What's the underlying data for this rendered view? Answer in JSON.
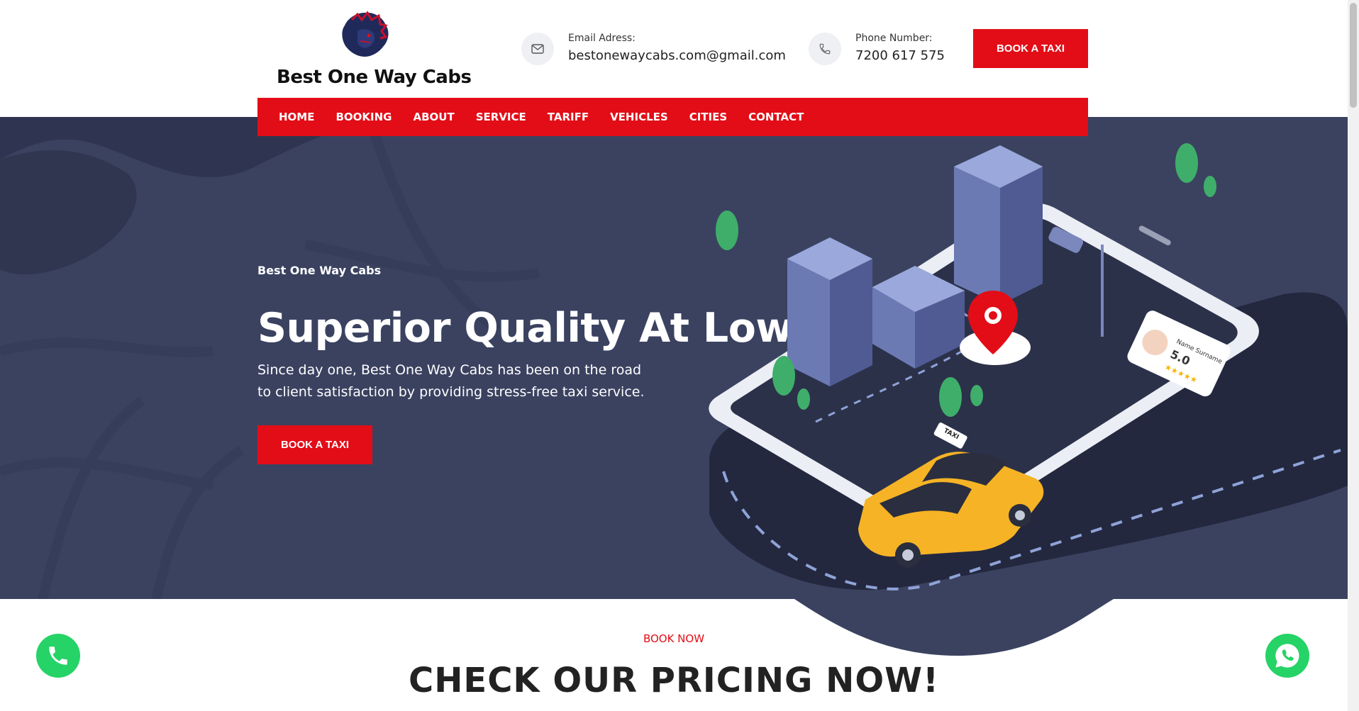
{
  "brand": {
    "name": "Best One Way Cabs"
  },
  "contact": {
    "email_label": "Email Adress:",
    "email": "bestonewaycabs.com@gmail.com",
    "phone_label": "Phone Number:",
    "phone": "7200 617 575"
  },
  "header": {
    "cta_label": "BOOK A TAXI"
  },
  "nav": {
    "items": [
      "HOME",
      "BOOKING",
      "ABOUT",
      "SERVICE",
      "TARIFF",
      "VEHICLES",
      "CITIES",
      "CONTACT"
    ]
  },
  "hero": {
    "subtitle": "Best One Way Cabs",
    "title": "Superior Quality At Low Cost.",
    "description": "Since day one, Best One Way Cabs has been on the road to client satisfaction by providing stress-free taxi service.",
    "cta_label": "BOOK A TAXI",
    "review_name": "Name Surname",
    "review_rating": "5.0",
    "taxi_sign": "TAXI"
  },
  "pricing": {
    "eyebrow": "BOOK NOW",
    "title": "CHECK OUR PRICING NOW!"
  },
  "floating": {
    "call_icon": "phone-icon",
    "whatsapp_icon": "whatsapp-icon"
  },
  "colors": {
    "accent": "#e20d17",
    "hero_bg": "#3b4260",
    "whatsapp": "#25d366"
  }
}
